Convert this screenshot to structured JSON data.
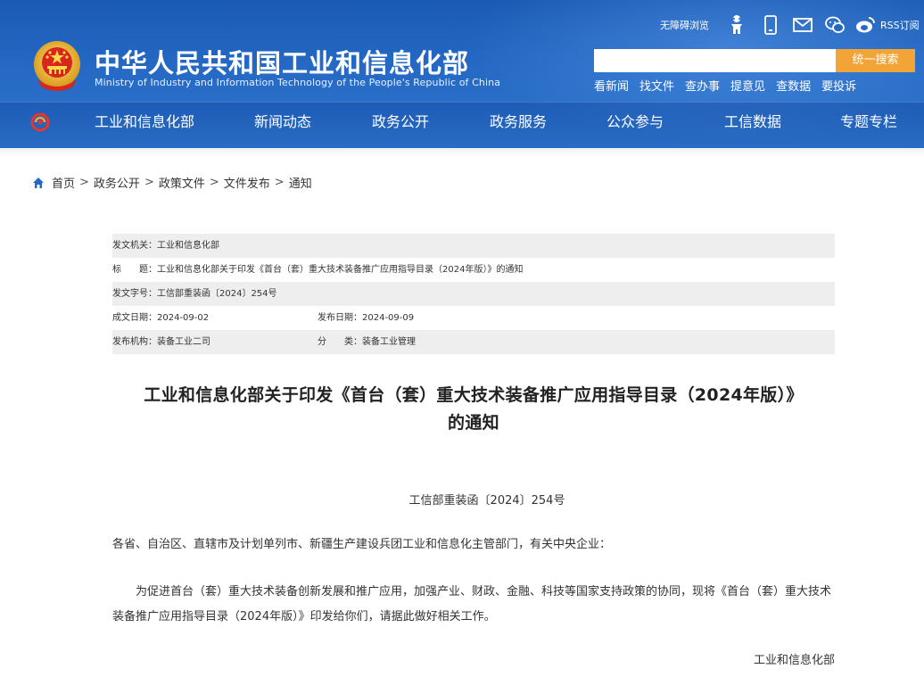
{
  "header": {
    "site_title": "中华人民共和国工业和信息化部",
    "site_subtitle": "Ministry of Industry and Information Technology of the People's Republic of China",
    "accessibility_label": "无障碍浏览",
    "rss_label": "RSS订阅",
    "search": {
      "placeholder": "",
      "button_label": "统一搜索"
    },
    "quicklinks": [
      "看新闻",
      "找文件",
      "查办事",
      "提意见",
      "查数据",
      "要投诉"
    ],
    "nav": [
      "工业和信息化部",
      "新闻动态",
      "政务公开",
      "政务服务",
      "公众参与",
      "工信数据",
      "专题专栏"
    ]
  },
  "breadcrumb": {
    "items": [
      "首页",
      "政务公开",
      "政策文件",
      "文件发布",
      "通知"
    ],
    "separator": ">"
  },
  "meta": {
    "issuer_label": "发文机关：",
    "issuer_value": "工业和信息化部",
    "title_label": "标　　题：",
    "title_value": "工业和信息化部关于印发《首台（套）重大技术装备推广应用指导目录（2024年版）》的通知",
    "docno_label": "发文字号：",
    "docno_value": "工信部重装函〔2024〕254号",
    "created_label": "成文日期：",
    "created_value": "2024-09-02",
    "published_label": "发布日期：",
    "published_value": "2024-09-09",
    "org_label": "发布机构：",
    "org_value": "装备工业二司",
    "category_label": "分　　类：",
    "category_value": "装备工业管理"
  },
  "article": {
    "title_line1": "工业和信息化部关于印发《首台（套）重大技术装备推广应用指导目录（2024年版）》",
    "title_line2": "的通知",
    "docnum": "工信部重装函〔2024〕254号",
    "salutation": "各省、自治区、直辖市及计划单列市、新疆生产建设兵团工业和信息化主管部门，有关中央企业：",
    "body": "为促进首台（套）重大技术装备创新发展和推广应用，加强产业、财政、金融、科技等国家支持政策的协同，现将《首台（套）重大技术装备推广应用指导目录（2024年版）》印发给你们，请据此做好相关工作。",
    "signature": "工业和信息化部"
  },
  "colors": {
    "header_blue": "#2569c4",
    "search_button": "#f3a437",
    "meta_shade": "#eeeeee"
  },
  "icons": [
    "emblem-icon",
    "accessibility-icon",
    "mobile-icon",
    "mail-icon",
    "wechat-icon",
    "weibo-icon",
    "home-icon",
    "nav-logo-icon"
  ]
}
